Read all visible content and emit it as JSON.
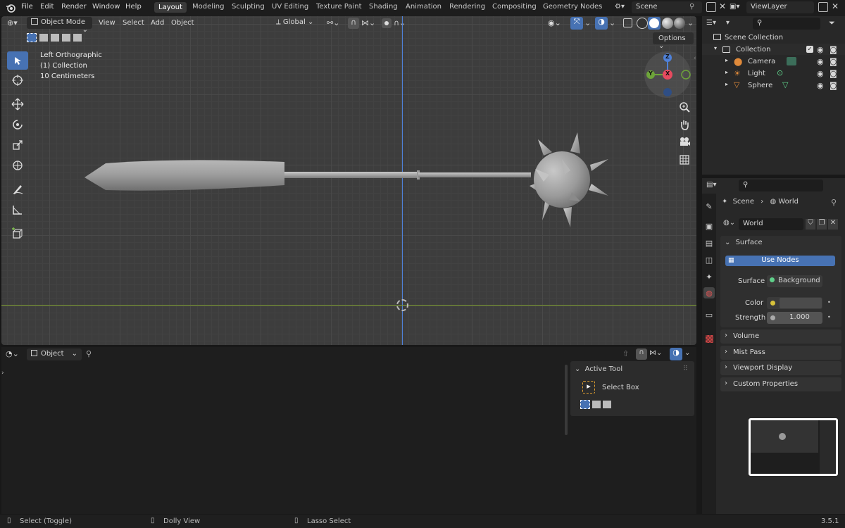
{
  "topbar": {
    "menus": [
      "File",
      "Edit",
      "Render",
      "Window",
      "Help"
    ],
    "workspaces": [
      "Layout",
      "Modeling",
      "Sculpting",
      "UV Editing",
      "Texture Paint",
      "Shading",
      "Animation",
      "Rendering",
      "Compositing",
      "Geometry Nodes"
    ],
    "scene": "Scene",
    "view_layer": "ViewLayer"
  },
  "viewport": {
    "mode": "Object Mode",
    "menus": [
      "View",
      "Select",
      "Add",
      "Object"
    ],
    "orientation": "Global",
    "options": "Options",
    "overlay_lines": [
      "Left Orthographic",
      "(1) Collection",
      "10 Centimeters"
    ],
    "gizmo_axes": {
      "z": "Z",
      "y": "Y",
      "x": "X"
    }
  },
  "outliner": {
    "scene_collection": "Scene Collection",
    "collection": "Collection",
    "items": [
      {
        "name": "Camera",
        "icon": "camera-icon"
      },
      {
        "name": "Light",
        "icon": "light-icon"
      },
      {
        "name": "Sphere",
        "icon": "mesh-icon"
      }
    ]
  },
  "properties": {
    "breadcrumb_scene": "Scene",
    "breadcrumb_world": "World",
    "world_name": "World",
    "surface_panel": "Surface",
    "use_nodes": "Use Nodes",
    "surface_label": "Surface",
    "surface_value": "Background",
    "color_label": "Color",
    "strength_label": "Strength",
    "strength_value": "1.000",
    "collapsed_panels": [
      "Volume",
      "Mist Pass",
      "Viewport Display",
      "Custom Properties"
    ]
  },
  "timeline": {
    "mode": "Object",
    "active_tool_title": "Active Tool",
    "active_tool_name": "Select Box"
  },
  "statusbar": {
    "select": "Select (Toggle)",
    "dolly": "Dolly View",
    "lasso": "Lasso Select",
    "version": "3.5.1"
  },
  "colors": {
    "accent": "#4772b3",
    "x_axis": "#e84a5f",
    "y_axis": "#6ea53a",
    "z_axis": "#4f81d8"
  }
}
